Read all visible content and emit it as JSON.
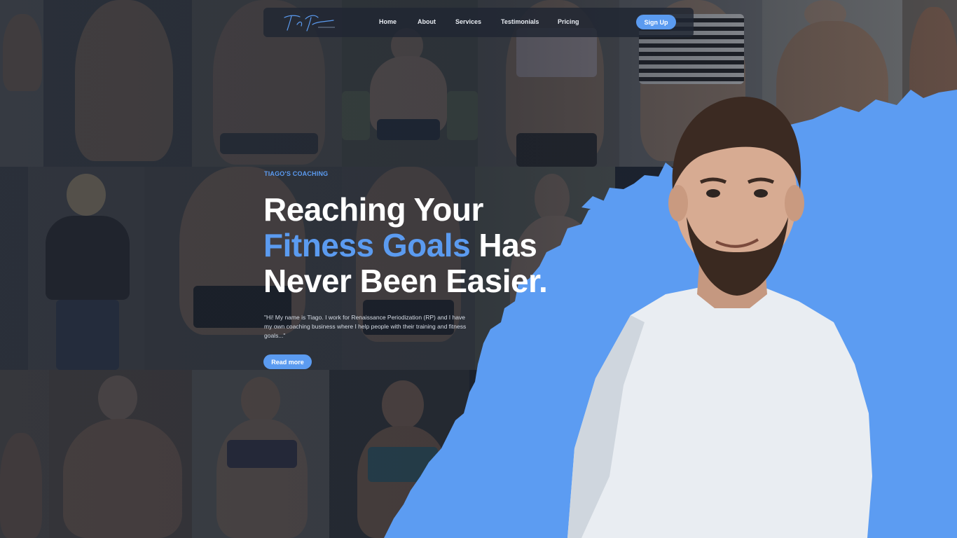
{
  "brand": {
    "logo_text": "Tiago Fedecchi"
  },
  "nav": {
    "links": [
      {
        "label": "Home"
      },
      {
        "label": "About"
      },
      {
        "label": "Services"
      },
      {
        "label": "Testimonials"
      },
      {
        "label": "Pricing"
      }
    ],
    "theme_toggle_icon": "moon-icon",
    "signup_label": "Sign Up"
  },
  "hero": {
    "eyebrow": "TIAGO'S COACHING",
    "headline_line1": "Reaching Your",
    "headline_accent": "Fitness Goals",
    "headline_line2_rest": " Has",
    "headline_line3": "Never Been Easier.",
    "intro": "\"Hi! My name is Tiago. I work for Renaissance Periodization (RP) and I have my own coaching business where I help people with their training and fitness goals...\"",
    "cta_label": "Read more"
  },
  "colors": {
    "accent": "#5b9bf0",
    "background": "#1f2733",
    "navbar": "#202632",
    "text": "#ffffff"
  }
}
